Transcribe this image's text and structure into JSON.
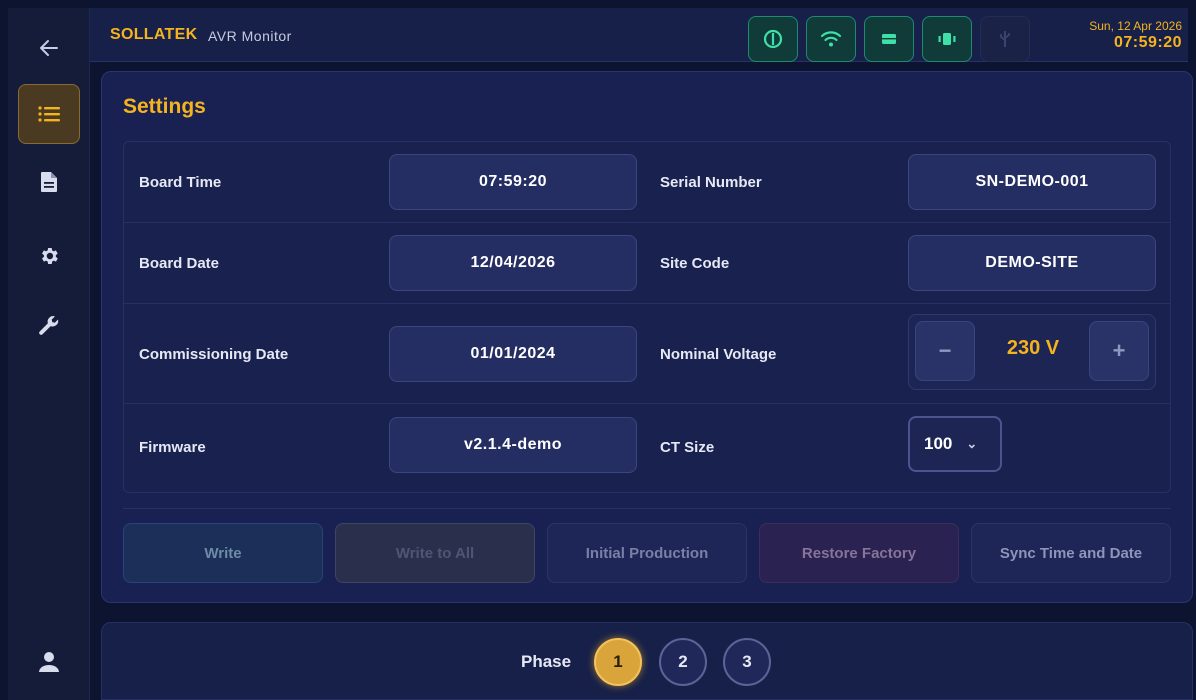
{
  "header": {
    "brand": "SOLLATEK",
    "subtitle": "AVR Monitor",
    "date": "Sun, 12 Apr 2026",
    "time": "07:59:20",
    "status_icons": [
      "power-icon",
      "wifi-icon",
      "battery-icon",
      "vibration-icon",
      "usb-icon"
    ]
  },
  "sidebar": {
    "items": [
      "back-arrow-icon",
      "list-icon",
      "document-icon",
      "gear-icon",
      "wrench-icon",
      "user-icon"
    ]
  },
  "settings": {
    "title": "Settings",
    "rows": [
      {
        "left_label": "Board Time",
        "left_value": "07:59:20",
        "right_label": "Serial Number",
        "right_value": "SN-DEMO-001"
      },
      {
        "left_label": "Board Date",
        "left_value": "12/04/2026",
        "right_label": "Site Code",
        "right_value": "DEMO-SITE"
      },
      {
        "left_label": "Commissioning Date",
        "left_value": "01/01/2024",
        "right_label": "Nominal Voltage",
        "right_value": "230 V",
        "minus": "−",
        "plus": "+"
      },
      {
        "left_label": "Firmware",
        "left_value": "v2.1.4-demo",
        "right_label": "CT Size",
        "right_value": "100"
      }
    ]
  },
  "actions": {
    "write": "Write",
    "write_all": "Write to All",
    "initial_production": "Initial Production",
    "restore_factory": "Restore Factory",
    "sync": "Sync Time and Date"
  },
  "footer": {
    "phase_label": "Phase",
    "phases": [
      "1",
      "2",
      "3"
    ],
    "active_phase": "1"
  },
  "colors": {
    "accent": "#f5b31e",
    "background": "#0d1430",
    "status_ok": "#1f8a72"
  }
}
